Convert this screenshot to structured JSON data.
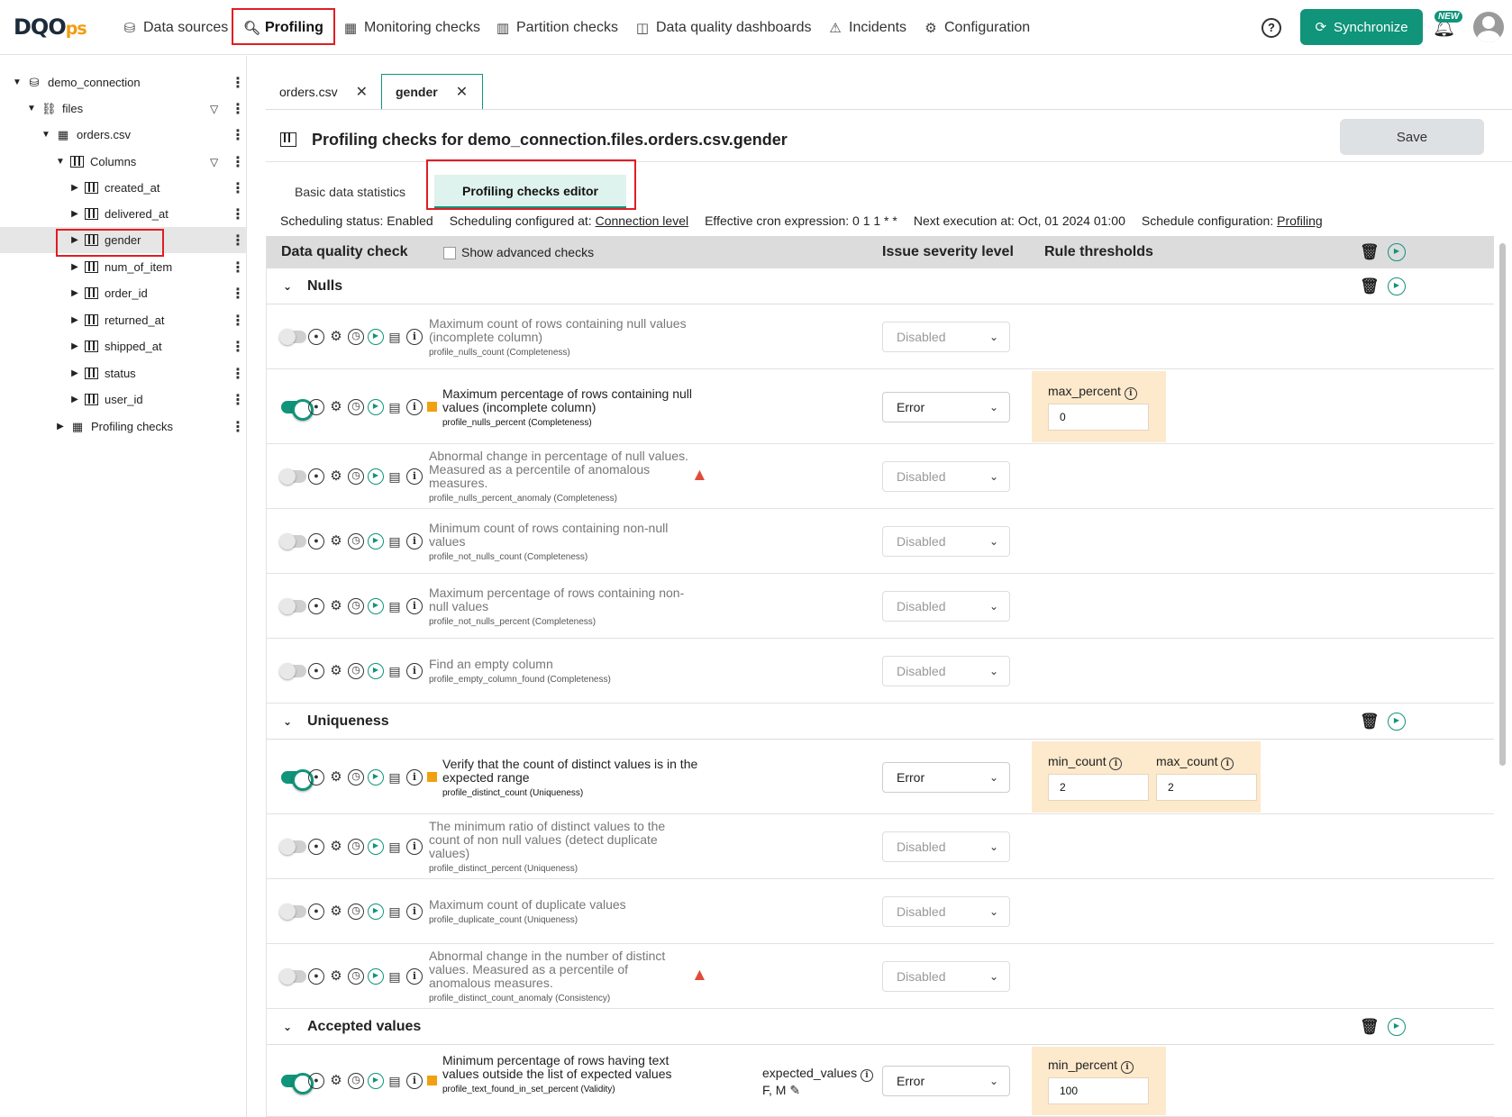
{
  "colors": {
    "accent": "#10947a",
    "highlight": "#e11d24",
    "threshold_bg": "#fde9cc",
    "error_square": "#f0a010"
  },
  "brand": {
    "logo_main": "DQO",
    "logo_suffix": "ps"
  },
  "nav": [
    {
      "label": "Data sources",
      "icon": "database-icon"
    },
    {
      "label": "Profiling",
      "icon": "profiling-icon"
    },
    {
      "label": "Monitoring checks",
      "icon": "table-icon"
    },
    {
      "label": "Partition checks",
      "icon": "partition-icon"
    },
    {
      "label": "Data quality dashboards",
      "icon": "dashboard-icon"
    },
    {
      "label": "Incidents",
      "icon": "warning-icon"
    },
    {
      "label": "Configuration",
      "icon": "gear-icon"
    }
  ],
  "topright": {
    "sync_label": "Synchronize",
    "new_badge": "NEW"
  },
  "tree": {
    "connection": "demo_connection",
    "schema": "files",
    "table": "orders.csv",
    "columns_label": "Columns",
    "columns": [
      "created_at",
      "delivered_at",
      "gender",
      "num_of_item",
      "order_id",
      "returned_at",
      "shipped_at",
      "status",
      "user_id"
    ],
    "profiling_checks": "Profiling checks"
  },
  "tabs": [
    {
      "label": "orders.csv"
    },
    {
      "label": "gender"
    }
  ],
  "page": {
    "title": "Profiling checks for demo_connection.files.orders.csv.gender",
    "save_label": "Save",
    "subtabs": [
      "Basic data statistics",
      "Profiling checks editor"
    ]
  },
  "schedule": {
    "status": "Scheduling status: Enabled",
    "configured_prefix": "Scheduling configured at:",
    "configured_link": "Connection level",
    "cron": "Effective cron expression: 0 1 1 * *",
    "next": "Next execution at: Oct, 01 2024 01:00",
    "config_prefix": "Schedule configuration:",
    "config_link": "Profiling"
  },
  "table_header": {
    "check": "Data quality check",
    "advanced": "Show advanced checks",
    "severity": "Issue severity level",
    "thresholds": "Rule thresholds"
  },
  "groups": {
    "nulls": "Nulls",
    "uniqueness": "Uniqueness",
    "accepted": "Accepted values"
  },
  "checks": [
    {
      "title": "Maximum count of rows containing null values (incomplete column)",
      "code": "profile_nulls_count",
      "category": "(Completeness)",
      "severity": "Disabled"
    },
    {
      "title": "Maximum percentage of rows containing null values (incomplete column)",
      "code": "profile_nulls_percent",
      "category": "(Completeness)",
      "severity": "Error",
      "thresholds": [
        {
          "label": "max_percent",
          "value": "0"
        }
      ]
    },
    {
      "title": "Abnormal change in percentage of null values. Measured as a percentile of anomalous measures.",
      "code": "profile_nulls_percent_anomaly",
      "category": "(Completeness)",
      "severity": "Disabled"
    },
    {
      "title": "Minimum count of rows containing non-null values",
      "code": "profile_not_nulls_count",
      "category": "(Completeness)",
      "severity": "Disabled"
    },
    {
      "title": "Maximum percentage of rows containing non-null values",
      "code": "profile_not_nulls_percent",
      "category": "(Completeness)",
      "severity": "Disabled"
    },
    {
      "title": "Find an empty column",
      "code": "profile_empty_column_found",
      "category": "(Completeness)",
      "severity": "Disabled"
    },
    {
      "title": "Verify that the count of distinct values is in the expected range",
      "code": "profile_distinct_count",
      "category": "(Uniqueness)",
      "severity": "Error",
      "thresholds": [
        {
          "label": "min_count",
          "value": "2"
        },
        {
          "label": "max_count",
          "value": "2"
        }
      ]
    },
    {
      "title": "The minimum ratio of distinct values to the count of non null values (detect duplicate values)",
      "code": "profile_distinct_percent",
      "category": "(Uniqueness)",
      "severity": "Disabled"
    },
    {
      "title": "Maximum count of duplicate values",
      "code": "profile_duplicate_count",
      "category": "(Uniqueness)",
      "severity": "Disabled"
    },
    {
      "title": "Abnormal change in the number of distinct values. Measured as a percentile of anomalous measures.",
      "code": "profile_distinct_count_anomaly",
      "category": "(Consistency)",
      "severity": "Disabled"
    },
    {
      "title": "Minimum percentage of rows having text values outside the list of expected values",
      "code": "profile_text_found_in_set_percent",
      "category": "(Validity)",
      "severity": "Error",
      "param_label": "expected_values",
      "param_value": "F, M",
      "thresholds": [
        {
          "label": "min_percent",
          "value": "100"
        }
      ]
    }
  ]
}
